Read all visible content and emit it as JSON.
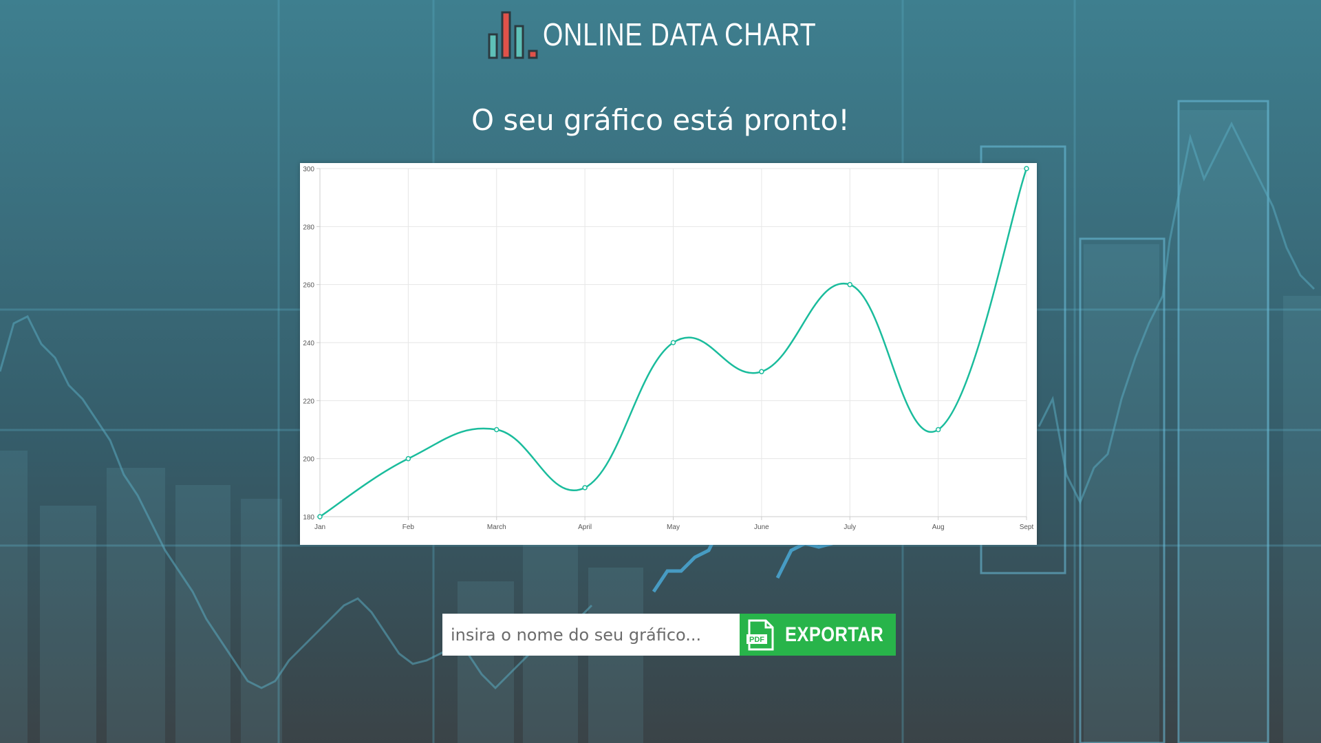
{
  "app": {
    "title": "ONLINE DATA CHART"
  },
  "page": {
    "subtitle": "O seu gráfico está pronto!"
  },
  "export": {
    "placeholder": "insira o nome do seu gráfico...",
    "button_label": "EXPORTAR",
    "icon": "pdf-file-icon"
  },
  "colors": {
    "line": "#1abc9c",
    "export_button": "#28b44a",
    "logo_teal": "#5fc1b8",
    "logo_red": "#e0524a",
    "logo_outline": "#2b3a40"
  },
  "chart_data": {
    "type": "line",
    "categories": [
      "Jan",
      "Feb",
      "March",
      "April",
      "May",
      "June",
      "July",
      "Aug",
      "Sept"
    ],
    "values": [
      180,
      200,
      210,
      190,
      240,
      230,
      260,
      210,
      300
    ],
    "y_ticks": [
      "180",
      "200",
      "220",
      "240",
      "260",
      "280",
      "300"
    ],
    "ylim": [
      180,
      300
    ],
    "grid": true,
    "smooth": true,
    "legend": "none"
  }
}
